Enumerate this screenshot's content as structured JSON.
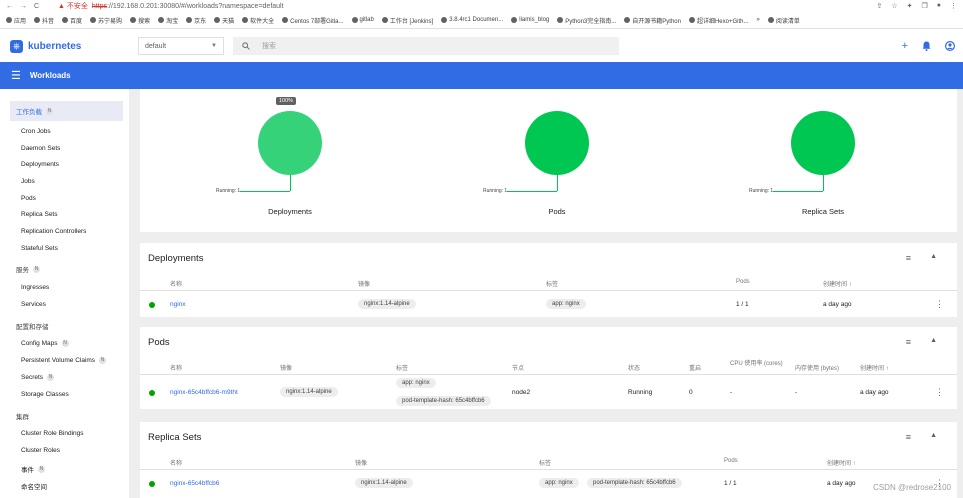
{
  "browser": {
    "nav_back": "←",
    "nav_forward": "→",
    "nav_reload": "C",
    "insecure_label": "▲ 不安全",
    "url_proto": "https",
    "url_rest": "://192.168.0.201:30080/#/workloads?namespace=default",
    "icons": [
      "share-icon",
      "star-icon",
      "extension-icon",
      "bookmark-icon",
      "profile-icon",
      "menu-icon"
    ],
    "bookmarks": [
      "应用",
      "抖音",
      "百度",
      "苏宁易购",
      "搜索",
      "淘宝",
      "京东",
      "天猫",
      "软件大全",
      "Centos 7部署Gitla...",
      "gitlab",
      "工作台 [Jenkins]",
      "3.8.4rc1 Documen...",
      "liamis_blog",
      "Python3完全指南...",
      "自开源书籍Python",
      "超详细Hexo+Gith...",
      "»",
      "阅读清单"
    ]
  },
  "header": {
    "brand": "kubernetes",
    "namespace": "default",
    "search_icon": "search-icon",
    "search_placeholder": "搜索",
    "add_icon": "+",
    "bell_icon": "🔔",
    "account_icon": "●"
  },
  "toolbar": {
    "menu_icon": "☰",
    "title": "Workloads"
  },
  "sidebar": {
    "items": [
      {
        "label": "工作负载",
        "type": "active",
        "badge": "N"
      },
      {
        "label": "Cron Jobs"
      },
      {
        "label": "Daemon Sets"
      },
      {
        "label": "Deployments"
      },
      {
        "label": "Jobs"
      },
      {
        "label": "Pods"
      },
      {
        "label": "Replica Sets"
      },
      {
        "label": "Replication Controllers"
      },
      {
        "label": "Stateful Sets"
      },
      {
        "label": "服务",
        "type": "section",
        "badge": "N"
      },
      {
        "label": "Ingresses"
      },
      {
        "label": "Services"
      },
      {
        "label": "配置和存储",
        "type": "section"
      },
      {
        "label": "Config Maps",
        "badge": "N"
      },
      {
        "label": "Persistent Volume Claims",
        "badge": "N"
      },
      {
        "label": "Secrets",
        "badge": "N"
      },
      {
        "label": "Storage Classes"
      },
      {
        "label": "集群",
        "type": "section"
      },
      {
        "label": "Cluster Role Bindings"
      },
      {
        "label": "Cluster Roles"
      },
      {
        "label": "事件",
        "badge": "N"
      },
      {
        "label": "命名空间"
      }
    ]
  },
  "charts": [
    {
      "label": "Deployments",
      "running": "Running: 1",
      "percent": "100%",
      "color": "#36d27a"
    },
    {
      "label": "Pods",
      "running": "Running: 1",
      "percent": "",
      "color": "#00c752"
    },
    {
      "label": "Replica Sets",
      "running": "Running: 1",
      "percent": "",
      "color": "#00c752"
    }
  ],
  "deployments": {
    "title": "Deployments",
    "headers": [
      "名称",
      "镜像",
      "标签",
      "Pods",
      "创建时间 ↑"
    ],
    "rows": [
      {
        "name": "nginx",
        "image": "nginx:1.14-alpine",
        "label": "app: nginx",
        "pods": "1 / 1",
        "created": "a day ago"
      }
    ]
  },
  "pods": {
    "title": "Pods",
    "headers": [
      "名称",
      "镜像",
      "标签",
      "节点",
      "状态",
      "重启",
      "CPU 使用率 (cores)",
      "内存使用 (bytes)",
      "创建时间 ↑"
    ],
    "rows": [
      {
        "name": "nginx-65c4bffcb6-m9tht",
        "image": "nginx:1.14-alpine",
        "labels": [
          "app: nginx",
          "pod-template-hash: 65c4bffcb6"
        ],
        "node": "node2",
        "status": "Running",
        "restarts": "0",
        "cpu": "-",
        "memory": "-",
        "created": "a day ago"
      }
    ]
  },
  "replicasets": {
    "title": "Replica Sets",
    "headers": [
      "名称",
      "镜像",
      "标签",
      "Pods",
      "创建时间 ↑"
    ],
    "rows": [
      {
        "name": "nginx-65c4bffcb6",
        "image": "nginx:1.14-alpine",
        "labels": [
          "app: nginx",
          "pod-template-hash: 65c4bffcb6"
        ],
        "pods": "1 / 1",
        "created": "a day ago"
      }
    ]
  },
  "card_icons": {
    "filter": "≡",
    "collapse": "▲",
    "kebab": "⋮"
  },
  "watermark": "CSDN @redrose2100"
}
